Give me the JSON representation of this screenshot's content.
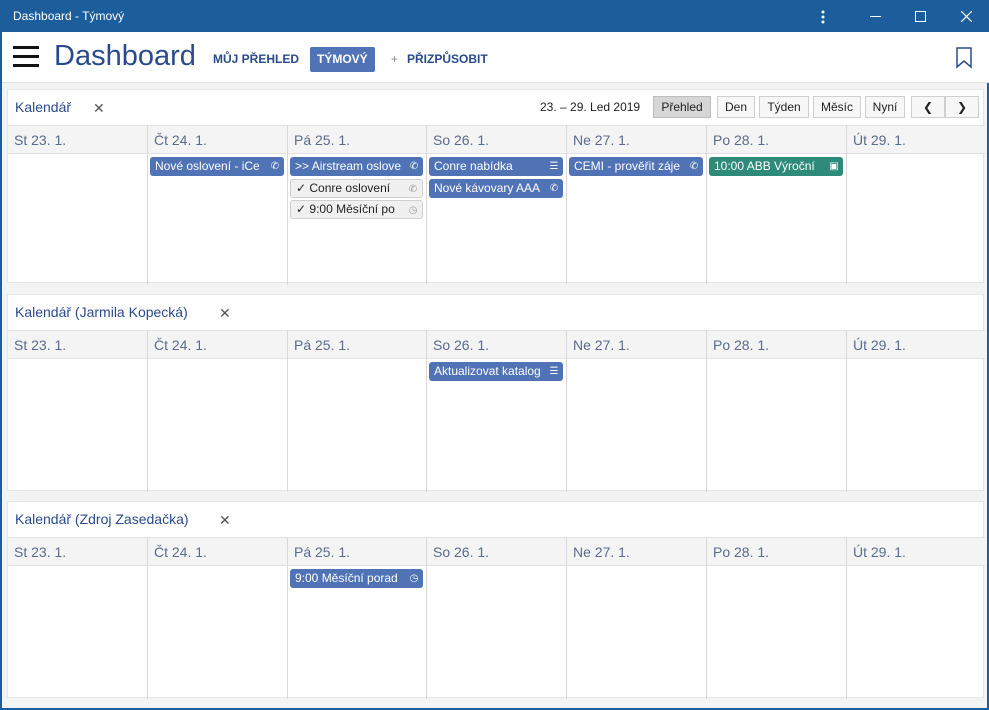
{
  "window": {
    "title": "Dashboard - Týmový",
    "controls": [
      "more-icon",
      "minimize-icon",
      "maximize-icon",
      "close-icon"
    ]
  },
  "header": {
    "title": "Dashboard",
    "nav": {
      "my_overview": "MŮJ PŘEHLED",
      "team": "TÝMOVÝ",
      "customize": "PŘIZPŮSOBIT",
      "customize_prefix": "+"
    }
  },
  "toolbar": {
    "range": "23. – 29. Led 2019",
    "views": {
      "overview": "Přehled",
      "day": "Den",
      "week": "Týden",
      "month": "Měsíc",
      "now": "Nyní"
    },
    "prev": "❮",
    "next": "❯"
  },
  "days": [
    "St 23. 1.",
    "Čt 24. 1.",
    "Pá 25. 1.",
    "So 26. 1.",
    "Ne 27. 1.",
    "Po 28. 1.",
    "Út 29. 1."
  ],
  "panels": [
    {
      "title": "Kalendář",
      "events": [
        {
          "day": 1,
          "row": 0,
          "label": "Nové oslovení - iCe",
          "icon": "phone-icon",
          "style": "blue"
        },
        {
          "day": 2,
          "row": 0,
          "label": ">> Airstream oslove",
          "icon": "phone-icon",
          "style": "blue"
        },
        {
          "day": 2,
          "row": 1,
          "label": "✓  Conre oslovení",
          "icon": "phone-icon",
          "style": "done"
        },
        {
          "day": 2,
          "row": 2,
          "label": "✓  9:00 Měsíční po",
          "icon": "clock-icon",
          "style": "done"
        },
        {
          "day": 3,
          "row": 0,
          "label": "Conre nabídka",
          "icon": "checklist-icon",
          "style": "blue"
        },
        {
          "day": 3,
          "row": 1,
          "label": "Nové kávovary AAA",
          "icon": "phone-icon",
          "style": "blue"
        },
        {
          "day": 4,
          "row": 0,
          "label": "CEMI - prověřit záje",
          "icon": "phone-icon",
          "style": "blue"
        },
        {
          "day": 5,
          "row": 0,
          "label": "10:00 ABB Výroční",
          "icon": "briefcase-icon",
          "style": "green"
        }
      ]
    },
    {
      "title": "Kalendář (Jarmila Kopecká)",
      "events": [
        {
          "day": 3,
          "row": 0,
          "label": "Aktualizovat katalog",
          "icon": "checklist-icon",
          "style": "blue"
        }
      ]
    },
    {
      "title": "Kalendář (Zdroj Zasedačka)",
      "events": [
        {
          "day": 2,
          "row": 0,
          "label": "9:00 Měsíční porad",
          "icon": "clock-icon",
          "style": "blue"
        }
      ]
    }
  ]
}
